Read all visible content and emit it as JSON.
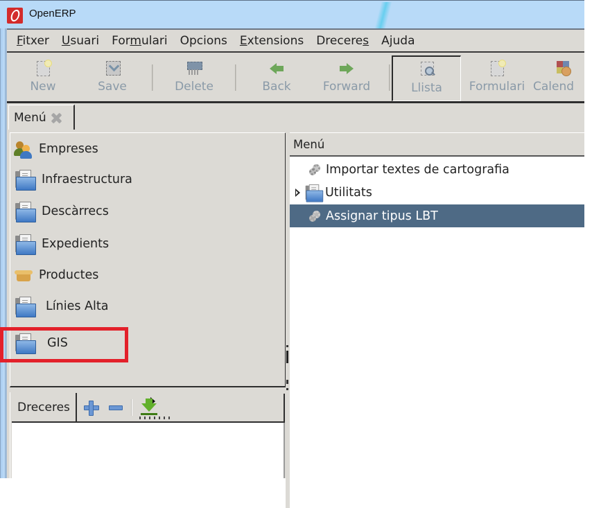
{
  "window": {
    "title": "OpenERP",
    "accent_color": "#d32b2b"
  },
  "menubar": {
    "items": [
      {
        "label": "Fitxer",
        "mnemonic_index": 0
      },
      {
        "label": "Usuari",
        "mnemonic_index": 0
      },
      {
        "label": "Formulari",
        "mnemonic_index": 3
      },
      {
        "label": "Opcions",
        "mnemonic_index": -1
      },
      {
        "label": "Extensions",
        "mnemonic_index": 0
      },
      {
        "label": "Dreceres",
        "mnemonic_index": 7
      },
      {
        "label": "Ajuda",
        "mnemonic_index": 1
      }
    ]
  },
  "toolbar": {
    "new_label": "New",
    "save_label": "Save",
    "delete_label": "Delete",
    "back_label": "Back",
    "forward_label": "Forward",
    "list_label": "Llista",
    "form_label": "Formulari",
    "calendar_label": "Calendar",
    "calendar_label_visible": "Calenc",
    "active_view": "Llista"
  },
  "tabs": [
    {
      "label": "Menú",
      "closable": true
    }
  ],
  "sidebar": {
    "items": [
      {
        "label": "Empreses",
        "icon": "partners-icon"
      },
      {
        "label": "Infraestructura",
        "icon": "folder-icon"
      },
      {
        "label": "Descàrrecs",
        "icon": "folder-icon"
      },
      {
        "label": "Expedients",
        "icon": "folder-icon"
      },
      {
        "label": "Productes",
        "icon": "product-box-icon"
      },
      {
        "label": "Línies Alta",
        "icon": "folder-icon"
      },
      {
        "label": "GIS",
        "icon": "folder-icon",
        "highlighted": true
      }
    ],
    "highlight_color": "#e3202a"
  },
  "shortcuts": {
    "label": "Dreceres",
    "add_icon": "plus-icon",
    "remove_icon": "minus-icon",
    "goto_icon": "download-arrow-icon",
    "items": []
  },
  "tree": {
    "header": "Menú",
    "rows": [
      {
        "label": "Importar textes de cartografia",
        "icon": "gears-icon",
        "expandable": false,
        "selected": false
      },
      {
        "label": "Utilitats",
        "icon": "folder-icon",
        "expandable": true,
        "selected": false
      },
      {
        "label": "Assignar tipus LBT",
        "icon": "gears-icon",
        "expandable": false,
        "selected": true
      }
    ],
    "selection_color": "#4e6a85"
  }
}
